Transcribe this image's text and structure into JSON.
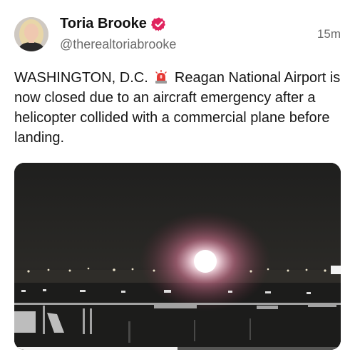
{
  "author": {
    "display_name": "Toria Brooke",
    "handle": "@therealtoriabrooke",
    "verified": true,
    "verified_badge_color": "#e0245e"
  },
  "timestamp": "15m",
  "post": {
    "text_before_emoji": "WASHINGTON, D.C.",
    "emoji": "siren-icon",
    "text_after_emoji": "Reagan National Airport is now closed due to an aircraft emergency after a helicopter collided with a commercial plane before landing."
  },
  "media": {
    "type": "video",
    "description_icon": "night-airport-video",
    "progress_fraction": 0.5
  }
}
